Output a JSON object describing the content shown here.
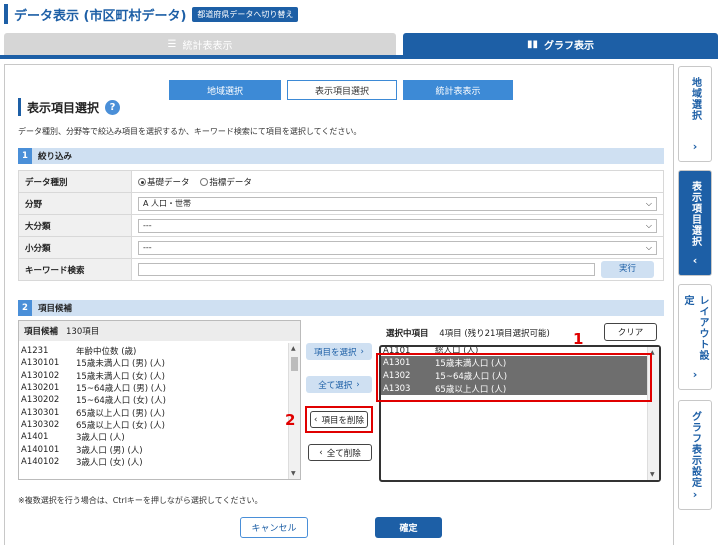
{
  "header": {
    "title": "データ表示 (市区町村データ)",
    "switch_label": "都道府県データへ切り替え"
  },
  "tabs": {
    "stat_label": "統計表表示",
    "graph_label": "グラフ表示"
  },
  "steps": [
    "地域選択",
    "表示項目選択",
    "統計表表示"
  ],
  "section_title": "表示項目選択",
  "description": "データ種別、分野等で絞込み項目を選択するか、キーワード検索にて項目を選択してください。",
  "filter": {
    "num": "1",
    "title": "絞り込み",
    "rows": {
      "data_type_label": "データ種別",
      "basic": "基礎データ",
      "index": "指標データ",
      "field_label": "分野",
      "field_value": "A 人口・世帯",
      "major_label": "大分類",
      "major_value": "---",
      "minor_label": "小分類",
      "minor_value": "---",
      "keyword_label": "キーワード検索",
      "run": "実行"
    }
  },
  "candidates": {
    "num": "2",
    "title": "項目候補",
    "panel_title": "項目候補",
    "count": "130項目",
    "items": [
      {
        "code": "A1231",
        "name": "年齢中位数 (歳)"
      },
      {
        "code": "A130101",
        "name": "15歳未満人口 (男) (人)"
      },
      {
        "code": "A130102",
        "name": "15歳未満人口 (女) (人)"
      },
      {
        "code": "A130201",
        "name": "15~64歳人口 (男) (人)"
      },
      {
        "code": "A130202",
        "name": "15~64歳人口 (女) (人)"
      },
      {
        "code": "A130301",
        "name": "65歳以上人口 (男) (人)"
      },
      {
        "code": "A130302",
        "name": "65歳以上人口 (女) (人)"
      },
      {
        "code": "A1401",
        "name": "3歳人口 (人)"
      },
      {
        "code": "A140101",
        "name": "3歳人口 (男) (人)"
      },
      {
        "code": "A140102",
        "name": "3歳人口 (女) (人)"
      }
    ]
  },
  "buttons": {
    "select": "項目を選択",
    "select_all": "全て選択",
    "delete": "項目を削除",
    "delete_all": "全て削除",
    "clear": "クリア",
    "cancel": "キャンセル",
    "ok": "確定"
  },
  "selected": {
    "title": "選択中項目",
    "info": "4項目 (残り21項目選択可能)",
    "items": [
      {
        "code": "A1101",
        "name": "総人口 (人)"
      },
      {
        "code": "A1301",
        "name": "15歳未満人口 (人)"
      },
      {
        "code": "A1302",
        "name": "15~64歳人口 (人)"
      },
      {
        "code": "A1303",
        "name": "65歳以上人口 (人)"
      }
    ]
  },
  "note": "※複数選択を行う場合は、Ctrlキーを押しながら選択してください。",
  "side_tabs": [
    "地域選択",
    "表示項目選択",
    "レイアウト設定",
    "グラフ表示設定"
  ],
  "annotations": {
    "one": "1",
    "two": "2"
  },
  "colors": {
    "primary": "#1d5fa6",
    "highlight": "#6e6e6e",
    "annotation": "#e00000"
  }
}
